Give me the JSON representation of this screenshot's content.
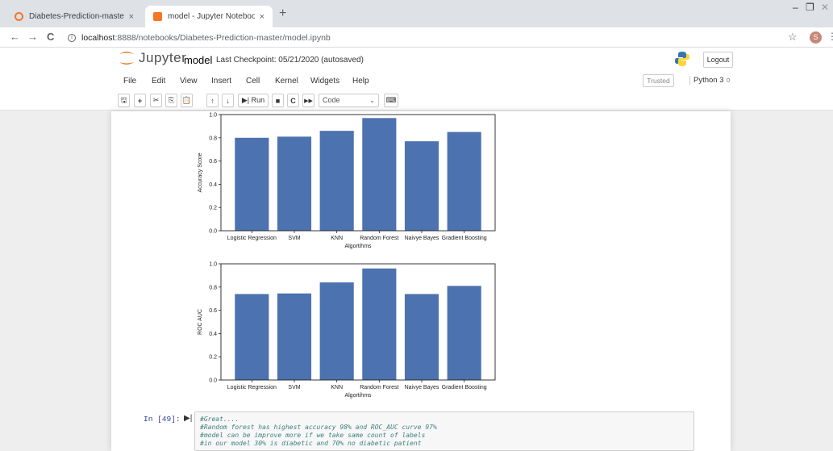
{
  "browser": {
    "tabs": [
      {
        "title": "Diabetes-Prediction-master/",
        "close": "×",
        "active": false
      },
      {
        "title": "model - Jupyter Notebook",
        "close": "×",
        "active": true
      }
    ],
    "new_tab": "+",
    "window_controls": {
      "minimize": "–",
      "restore": "❐",
      "close": "✕"
    },
    "nav": {
      "back": "←",
      "forward": "→",
      "reload": "C"
    },
    "url_host": "localhost",
    "url_path": ":8888/notebooks/Diabetes-Prediction-master/model.ipynb",
    "profile_initial": "S",
    "star": "☆",
    "menu_dots": "⋮"
  },
  "jupyter": {
    "logo_text": "Jupyter",
    "notebook_name": "model",
    "checkpoint": "Last Checkpoint: 05/21/2020  (autosaved)",
    "logout_label": "Logout",
    "menus": [
      "File",
      "Edit",
      "View",
      "Insert",
      "Cell",
      "Kernel",
      "Widgets",
      "Help"
    ],
    "trusted_label": "Trusted",
    "kernel_label": "Python 3 ○",
    "toolbar": {
      "save": "🖫",
      "add": "+",
      "cut": "✂",
      "copy": "⎘",
      "paste": "📋",
      "up": "↑",
      "down": "↓",
      "run": "▶| Run",
      "stop": "■",
      "restart": "C",
      "fastforward": "▶▶",
      "cell_type": "Code",
      "caret": "⌄",
      "keyboard": "⌨"
    }
  },
  "chart_data": [
    {
      "type": "bar",
      "categories": [
        "Logistic Regression",
        "SVM",
        "KNN",
        "Random Forest",
        "Naivye Bayes",
        "Gradient Boosting"
      ],
      "values": [
        0.8,
        0.81,
        0.86,
        0.97,
        0.77,
        0.85
      ],
      "xlabel": "Algortihms",
      "ylabel": "Accuracy Score",
      "ylim": [
        0,
        1.0
      ],
      "yticks": [
        "0.0",
        "0.2",
        "0.4",
        "0.6",
        "0.8",
        "1.0"
      ],
      "color": "#4c72b0"
    },
    {
      "type": "bar",
      "categories": [
        "Logistic Regression",
        "SVM",
        "KNN",
        "Random Forest",
        "Naivye Bayes",
        "Gradient Boosting"
      ],
      "values": [
        0.74,
        0.745,
        0.84,
        0.96,
        0.74,
        0.81
      ],
      "xlabel": "Algortihms",
      "ylabel": "ROC AUC",
      "ylim": [
        0,
        1.0
      ],
      "yticks": [
        "0.0",
        "0.2",
        "0.4",
        "0.6",
        "0.8",
        "1.0"
      ],
      "color": "#4c72b0"
    }
  ],
  "cell": {
    "prompt": "In [49]:",
    "run_indicator": "▶|",
    "lines": [
      "#Great....",
      "#Random forest has highest accuracy 98% and ROC_AUC curve 97%",
      "#model can be improve more if we take same count of labels",
      "#in our model 30% is diabetic and 70% no diabetic patient"
    ]
  }
}
